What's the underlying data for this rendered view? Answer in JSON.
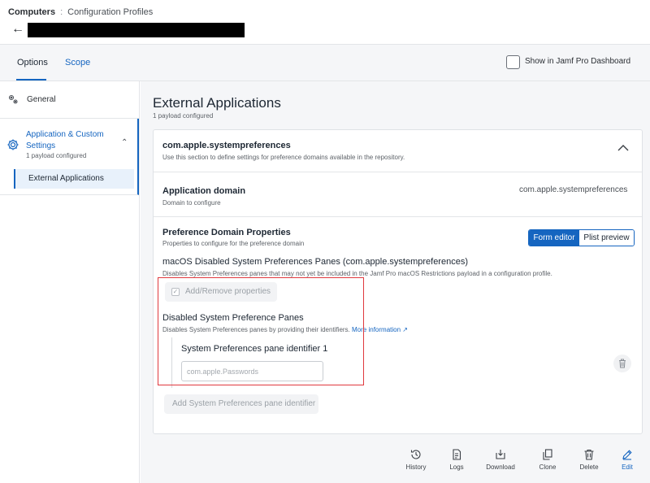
{
  "breadcrumb": {
    "section": "Computers",
    "separator": ":",
    "page": "Configuration Profiles"
  },
  "tabs": {
    "options": "Options",
    "scope": "Scope"
  },
  "dashboard": {
    "label": "Show in Jamf Pro Dashboard",
    "checked": false
  },
  "sidebar": {
    "general": "General",
    "app_custom": "Application & Custom Settings",
    "app_custom_sub": "1 payload configured",
    "external_apps": "External Applications"
  },
  "main": {
    "title": "External Applications",
    "subtitle": "1 payload configured",
    "domain_section": {
      "title": "com.apple.systempreferences",
      "desc": "Use this section to define settings for preference domains available in the repository."
    },
    "app_domain": {
      "title": "Application domain",
      "desc": "Domain to configure",
      "value": "com.apple.systempreferences"
    },
    "pref_props": {
      "title": "Preference Domain Properties",
      "desc": "Properties to configure for the preference domain",
      "form_editor": "Form editor",
      "plist_preview": "Plist preview"
    },
    "macos": {
      "title": "macOS Disabled System Preferences Panes (com.apple.systempreferences)",
      "desc": "Disables System Preferences panes that may not yet be included in the Jamf Pro macOS Restrictions payload in a configuration profile."
    },
    "add_remove": "Add/Remove properties",
    "disabled_panes": {
      "title": "Disabled System Preference Panes",
      "desc": "Disables System Preferences panes by providing their identifiers.",
      "more_info": "More information"
    },
    "pane_identifier": {
      "label": "System Preferences pane identifier 1",
      "placeholder": "com.apple.Passwords"
    },
    "add_identifier": "Add System Preferences pane identifier"
  },
  "actions": {
    "history": "History",
    "logs": "Logs",
    "download": "Download",
    "clone": "Clone",
    "delete": "Delete",
    "edit": "Edit"
  },
  "colors": {
    "accent": "#1565c0",
    "highlight_box": "#e0393e"
  }
}
